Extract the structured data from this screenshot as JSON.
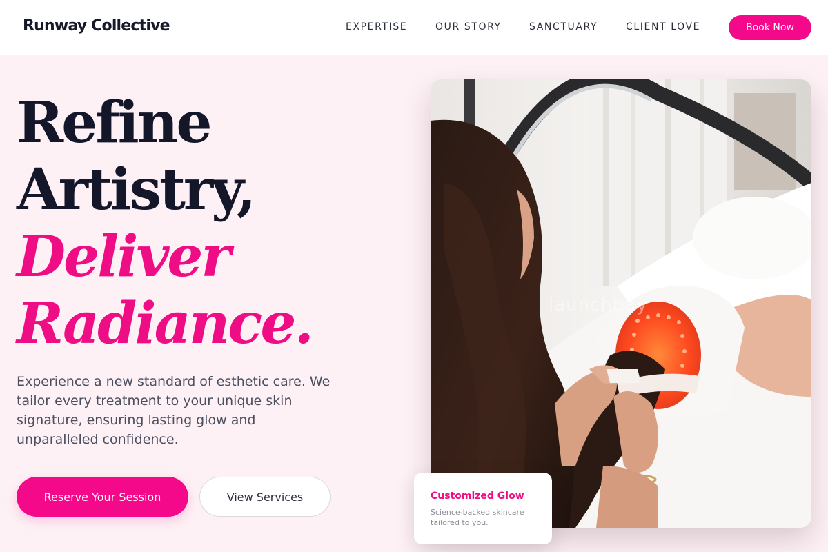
{
  "header": {
    "logo": "Runway Collective",
    "nav": [
      "EXPERTISE",
      "OUR STORY",
      "SANCTUARY",
      "CLIENT LOVE"
    ],
    "cta": "Book Now"
  },
  "hero": {
    "headline": [
      "Refine",
      "Artistry,",
      "Deliver",
      "Radiance."
    ],
    "description": "Experience a new standard of esthetic care. We tailor every treatment to your unique skin signature, ensuring lasting glow and unparalleled confidence.",
    "primary_button": "Reserve Your Session",
    "secondary_button": "View Services",
    "image_watermark": "launchbay"
  },
  "card": {
    "title": "Customized Glow",
    "text": "Science-backed skincare tailored to you."
  },
  "colors": {
    "accent": "#f3098a",
    "headline_pink": "#ee0d84",
    "background": "#fdf1f5",
    "text_dark": "#14172a"
  }
}
